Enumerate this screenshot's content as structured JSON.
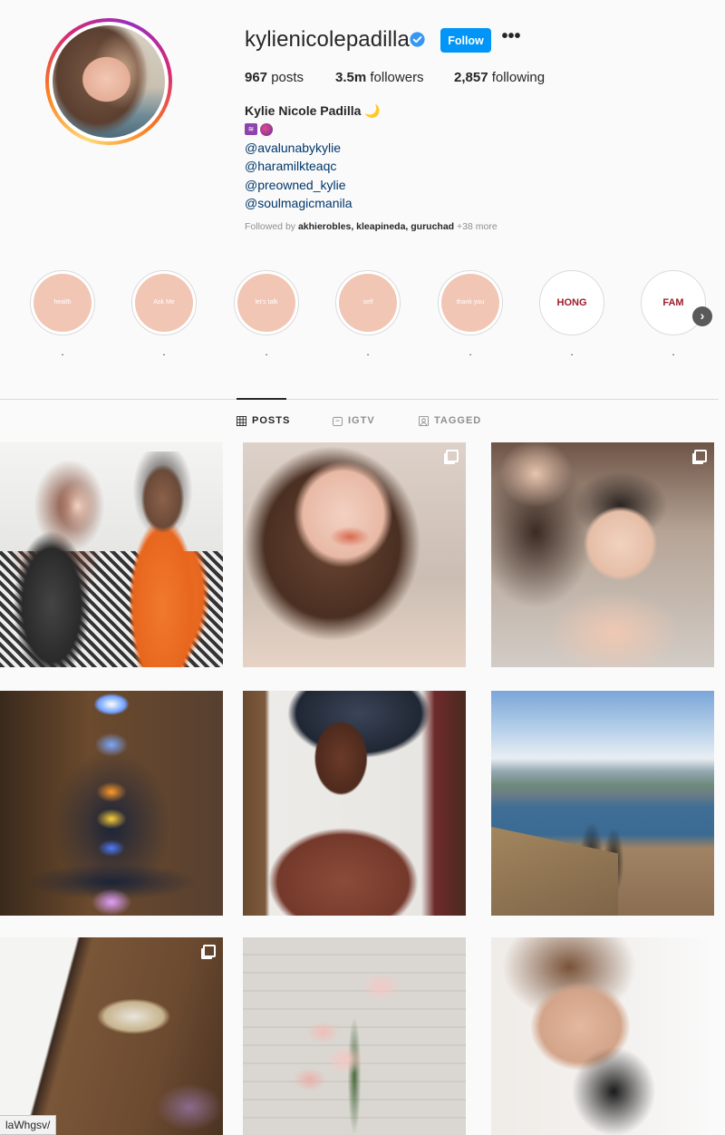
{
  "profile": {
    "username": "kylienicolepadilla",
    "follow_label": "Follow",
    "more_label": "•••",
    "stats": {
      "posts_count": "967",
      "posts_label": " posts",
      "followers_count": "3.5m",
      "followers_label": " followers",
      "following_count": "2,857",
      "following_label": " following"
    },
    "full_name": "Kylie Nicole Padilla 🌙",
    "bio_links": [
      "@avalunabykylie",
      "@haramilkteaqc",
      "@preowned_kylie",
      "@soulmagicmanila"
    ],
    "followed_by_prefix": "Followed by ",
    "followed_by_names": "akhierobles, kleapineda, guruchad",
    "followed_by_more": " +38 more"
  },
  "highlights": [
    {
      "cover_text": "health",
      "label": "."
    },
    {
      "cover_text": "Ask Me",
      "label": "."
    },
    {
      "cover_text": "let's talk",
      "label": "."
    },
    {
      "cover_text": "self",
      "label": "."
    },
    {
      "cover_text": "thank you",
      "label": "."
    },
    {
      "cover_text": "HONG KONG",
      "label": "."
    },
    {
      "cover_text": "FAM",
      "label": "."
    }
  ],
  "tabs": [
    {
      "label": "POSTS",
      "active": true,
      "icon": "grid-icon"
    },
    {
      "label": "IGTV",
      "active": false,
      "icon": "igtv-icon"
    },
    {
      "label": "TAGGED",
      "active": false,
      "icon": "tagged-icon"
    }
  ],
  "posts": [
    {
      "type": "photo",
      "multi": false
    },
    {
      "type": "photo",
      "multi": true
    },
    {
      "type": "photo",
      "multi": true
    },
    {
      "type": "photo",
      "multi": false
    },
    {
      "type": "photo",
      "multi": false
    },
    {
      "type": "photo",
      "multi": false
    },
    {
      "type": "photo",
      "multi": true
    },
    {
      "type": "photo",
      "multi": false
    },
    {
      "type": "photo",
      "multi": false
    }
  ],
  "status_bar": {
    "url_fragment": "laWhgsv/"
  },
  "colors": {
    "follow_button": "#0095f6",
    "link": "#00376b",
    "verified": "#3897f0",
    "highlight_cover": "#f2c6b4"
  }
}
